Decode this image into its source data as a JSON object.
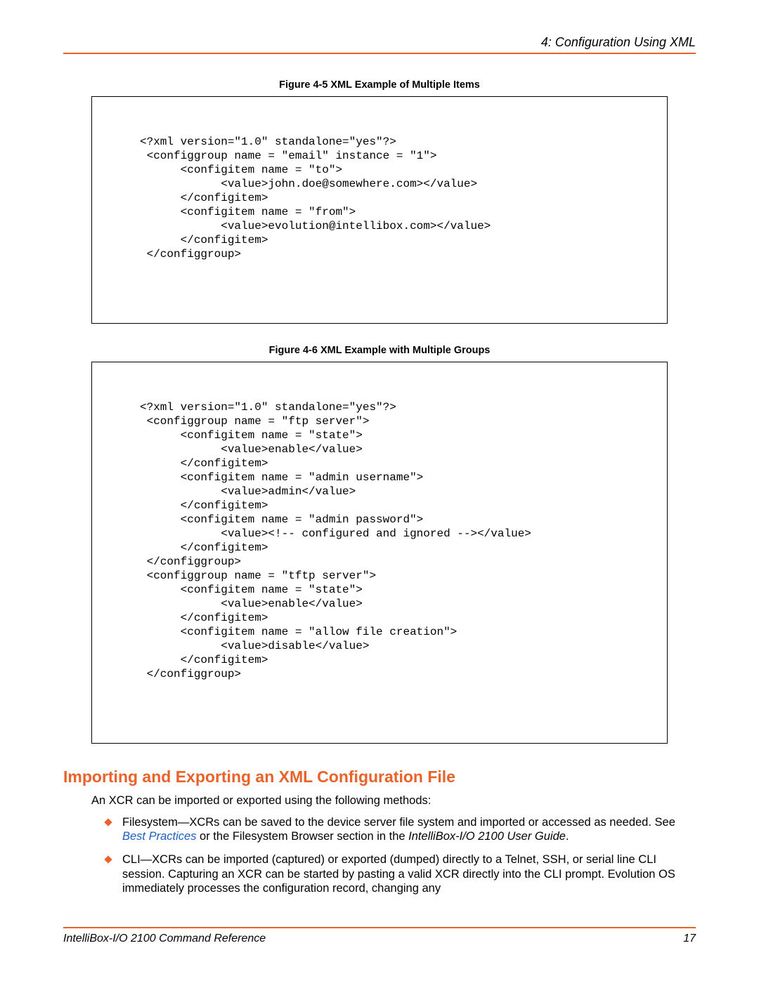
{
  "header": {
    "chapter_title": "4: Configuration Using XML"
  },
  "figure5": {
    "caption": "Figure 4-5  XML Example of Multiple Items",
    "code": "<?xml version=\"1.0\" standalone=\"yes\"?>\n <configgroup name = \"email\" instance = \"1\">\n      <configitem name = \"to\">\n            <value>john.doe@somewhere.com></value>\n      </configitem>\n      <configitem name = \"from\">\n            <value>evolution@intellibox.com></value>\n      </configitem>\n </configgroup>"
  },
  "figure6": {
    "caption": "Figure 4-6  XML Example with Multiple Groups",
    "code": "<?xml version=\"1.0\" standalone=\"yes\"?>\n <configgroup name = \"ftp server\">\n      <configitem name = \"state\">\n            <value>enable</value>\n      </configitem>\n      <configitem name = \"admin username\">\n            <value>admin</value>\n      </configitem>\n      <configitem name = \"admin password\">\n            <value><!-- configured and ignored --></value>\n      </configitem>\n </configgroup>\n <configgroup name = \"tftp server\">\n      <configitem name = \"state\">\n            <value>enable</value>\n      </configitem>\n      <configitem name = \"allow file creation\">\n            <value>disable</value>\n      </configitem>\n </configgroup>"
  },
  "section": {
    "heading": "Importing and Exporting an XML Configuration File",
    "intro": "An XCR can be imported or exported using the following methods:",
    "bullet1_a": "Filesystem—XCRs can be saved to the device server file system and imported or accessed as needed. See ",
    "bullet1_link": "Best Practices",
    "bullet1_b": " or the Filesystem Browser section in the ",
    "bullet1_em": "IntelliBox-I/O 2100 User Guide",
    "bullet1_c": ".",
    "bullet2": "CLI—XCRs can be imported (captured) or exported (dumped) directly to a Telnet, SSH, or serial line CLI session. Capturing an XCR can be started by pasting a valid XCR directly into the CLI prompt. Evolution OS immediately processes the configuration record, changing any"
  },
  "footer": {
    "doc_title": "IntelliBox-I/O 2100 Command Reference",
    "page_number": "17"
  }
}
